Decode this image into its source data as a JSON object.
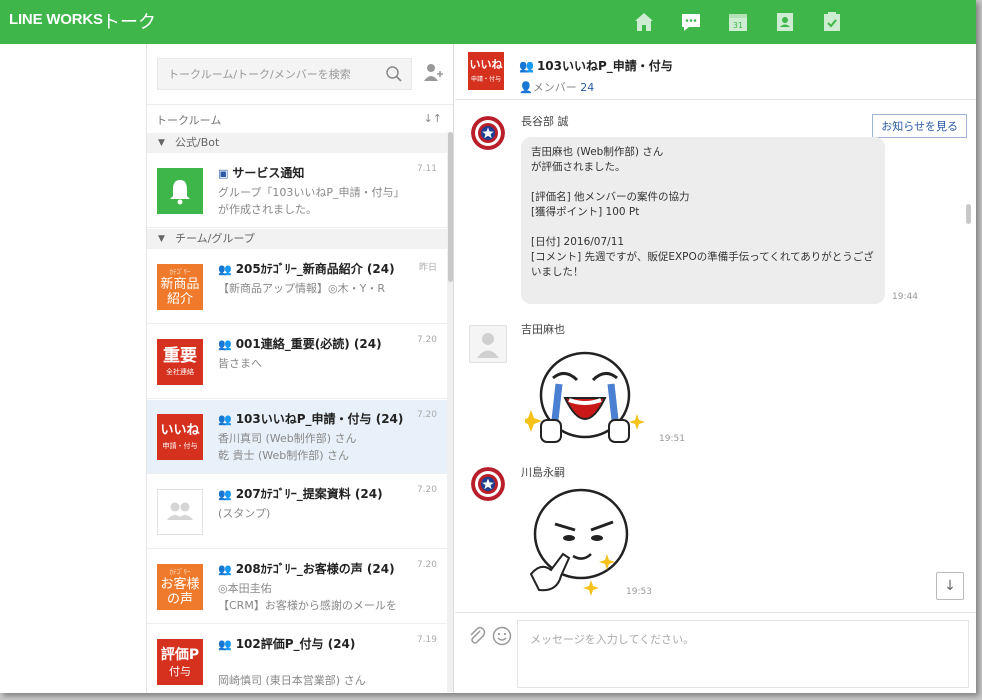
{
  "header": {
    "brand": "LINE WORKS",
    "title": "トーク",
    "accent_color": "#3eb649",
    "nav_icons": [
      "home-icon",
      "talk-icon",
      "calendar-icon",
      "contacts-icon",
      "task-icon"
    ]
  },
  "sidebar": {
    "search_placeholder": "トークルーム/トーク/メンバーを検索",
    "list_header": "トークルーム",
    "sort_label": "↓↑",
    "sections": [
      {
        "label": "公式/Bot"
      },
      {
        "label": "チーム/グループ"
      }
    ],
    "rooms": [
      {
        "name": "サービス通知",
        "time": "7.11",
        "message": "グループ「103いいねP_申請・付与」が作成されました。",
        "avatar_text": "",
        "avatar_color": "#3eb649"
      },
      {
        "name": "205ｶﾃｺﾞﾘｰ_新商品紹介 (24)",
        "time": "昨日",
        "message": "【新商品アップ情報】◎木・Y・R",
        "avatar_top": "ｶﾃｺﾞﾘｰ",
        "avatar_text": "新商品紹介",
        "avatar_color": "#f07a2b"
      },
      {
        "name": "001連絡_重要(必読) (24)",
        "time": "7.20",
        "message": "皆さまへ",
        "avatar_text": "重要",
        "avatar_sub": "全社連絡",
        "avatar_color": "#d6301e"
      },
      {
        "name": "103いいねP_申請・付与 (24)",
        "time": "7.20",
        "message": "香川真司 (Web制作部) さん\n乾 貴士 (Web制作部) さん",
        "avatar_text": "いいね",
        "avatar_sub": "申請・付与",
        "avatar_color": "#d6301e"
      },
      {
        "name": "207ｶﾃｺﾞﾘｰ_提案資料 (24)",
        "time": "7.20",
        "message": "(スタンプ)",
        "avatar_text": "",
        "avatar_color": "#ffffff"
      },
      {
        "name": "208ｶﾃｺﾞﾘｰ_お客様の声 (24)",
        "time": "7.20",
        "message": "◎本田圭佑\n【CRM】お客様から感謝のメールを",
        "avatar_top": "ｶﾃｺﾞﾘｰ",
        "avatar_text": "お客様の声",
        "avatar_color": "#f07a2b"
      },
      {
        "name": "102評価P_付与 (24)",
        "time": "7.19",
        "message": "\n岡崎慎司 (東日本営業部) さん",
        "avatar_text": "評価P",
        "avatar_sub": "付与",
        "avatar_color": "#d6301e"
      }
    ]
  },
  "chat": {
    "room_title": "103いいねP_申請・付与",
    "members_label": "メンバー",
    "members_count": "24",
    "notice_button": "お知らせを見る",
    "messages": [
      {
        "sender": "長谷部 誠",
        "text": "吉田麻也 (Web制作部) さん\nが評価されました。\n\n[評価名] 他メンバーの案件の協力\n[獲得ポイント] 100 Pt\n\n[日付] 2016/07/11\n[コメント] 先週ですが、販促EXPOの準備手伝ってくれてありがとうございました！",
        "time": "19:44"
      },
      {
        "sender": "吉田麻也",
        "time": "19:51"
      },
      {
        "sender": "川島永嗣",
        "time": "19:53"
      }
    ],
    "composer_placeholder": "メッセージを入力してください。",
    "scroll_down_label": "↓"
  }
}
